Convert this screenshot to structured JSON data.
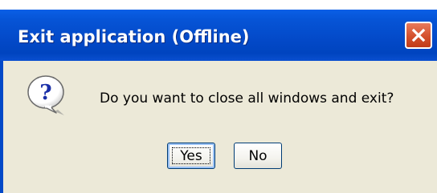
{
  "window": {
    "title": "Exit application (Offline)",
    "close_icon": "close-icon"
  },
  "dialog": {
    "icon": "question-icon",
    "message": "Do you want to close all windows and exit?",
    "buttons": {
      "yes_label": "Yes",
      "no_label": "No"
    }
  },
  "colors": {
    "titlebar": "#0349c8",
    "client_background": "#ece9d8",
    "close_button": "#d4502c",
    "button_border": "#003c74"
  }
}
